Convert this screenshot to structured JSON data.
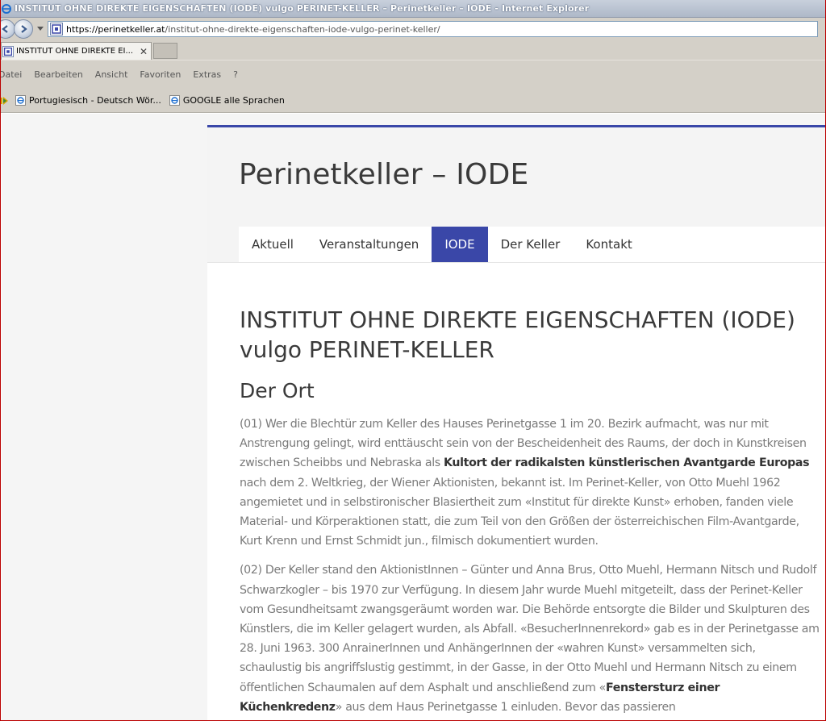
{
  "window": {
    "title": "INSTITUT OHNE DIREKTE EIGENSCHAFTEN (IODE) vulgo PERINET-KELLER – Perinetkeller – IODE - Internet Explorer"
  },
  "address": {
    "url_domain": "https://perinetkeller.at",
    "url_path": "/institut-ohne-direkte-eigenschaften-iode-vulgo-perinet-keller/"
  },
  "tabs": [
    {
      "label": "INSTITUT OHNE DIREKTE EI..."
    }
  ],
  "menu": [
    "Datei",
    "Bearbeiten",
    "Ansicht",
    "Favoriten",
    "Extras",
    "?"
  ],
  "favorites": [
    {
      "label": "Portugiesisch - Deutsch Wör..."
    },
    {
      "label": "GOOGLE alle Sprachen"
    }
  ],
  "site": {
    "title": "Perinetkeller – IODE",
    "nav": [
      {
        "label": "Aktuell",
        "active": false
      },
      {
        "label": "Veranstaltungen",
        "active": false
      },
      {
        "label": "IODE",
        "active": true
      },
      {
        "label": "Der Keller",
        "active": false
      },
      {
        "label": "Kontakt",
        "active": false
      }
    ]
  },
  "article": {
    "title": "INSTITUT OHNE DIREKTE EIGENSCHAFTEN (IODE) vulgo PERINET-KELLER",
    "section": "Der Ort",
    "para1_a": "(01) Wer die Blechtür zum Keller des Hauses Perinetgasse 1 im 20. Bezirk aufmacht, was nur mit Anstrengung gelingt, wird enttäuscht sein von der Bescheidenheit des Raums, der doch in Kunstkreisen zwischen Scheibbs und Nebraska als ",
    "para1_bold": "Kultort der radikalsten künstlerischen Avantgarde Europas",
    "para1_b": " nach dem 2. Weltkrieg, der Wiener Aktionisten, bekannt ist. Im Perinet-Keller, von Otto Muehl 1962 angemietet und in selbstironischer Blasiertheit zum «Institut für direkte Kunst» erhoben, fanden viele Material- und Körperaktionen statt, die zum Teil von den Größen der österreichischen Film-Avantgarde, Kurt Krenn und Ernst Schmidt jun., filmisch dokumentiert wurden.",
    "para2_a": "(02) Der Keller stand den AktionistInnen – Günter und Anna Brus, Otto Muehl, Hermann Nitsch und Rudolf Schwarzkogler – bis 1970 zur Verfügung. In diesem Jahr wurde Muehl mitgeteilt, dass der Perinet-Keller vom Gesundheitsamt zwangsgeräumt worden war. Die Behörde entsorgte die Bilder und Skulpturen des Künstlers, die im Keller gelagert wurden, als Abfall. «BesucherInnenrekord» gab es in der Perinetgasse am 28. Juni 1963. 300 AnrainerInnen und AnhängerInnen der «wahren Kunst» versammelten sich, schaulustig bis angriffslustig gestimmt, in der Gasse, in der Otto Muehl und Hermann Nitsch zu einem öffentlichen Schaumalen auf dem Asphalt und anschließend zum «",
    "para2_bold": "Fenstersturz einer Küchenkredenz",
    "para2_b": "» aus dem Haus Perinetgasse 1 einluden. Bevor das passieren"
  }
}
